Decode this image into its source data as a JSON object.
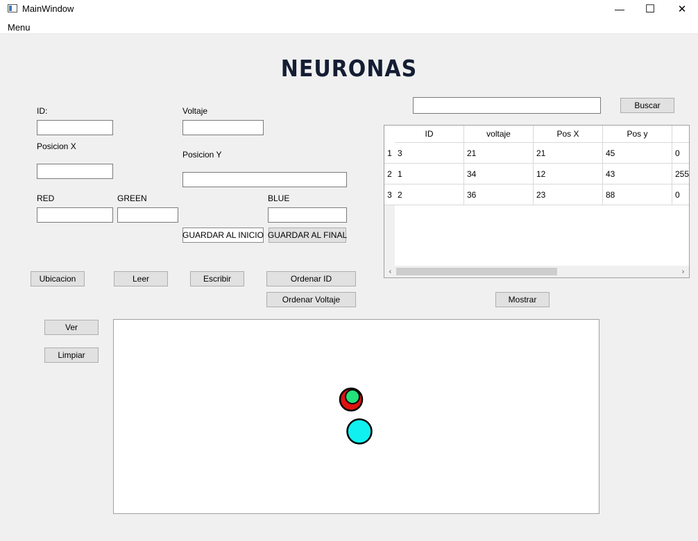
{
  "window": {
    "title": "MainWindow",
    "minimize": "—",
    "maximize": "☐",
    "close": "✕"
  },
  "menu": {
    "items": [
      "Menu"
    ]
  },
  "heading": "NEURONAS",
  "form": {
    "id_label": "ID:",
    "voltaje_label": "Voltaje",
    "posx_label": "Posicion X",
    "posy_label": "Posicion Y",
    "red_label": "RED",
    "green_label": "GREEN",
    "blue_label": "BLUE",
    "id_value": "",
    "voltaje_value": "",
    "posx_value": "",
    "posy_value": "",
    "red_value": "",
    "green_value": "",
    "blue_value": "",
    "save_start": "GUARDAR AL INICIO",
    "save_end": "GUARDAR AL FINAL"
  },
  "search": {
    "value": "",
    "button": "Buscar"
  },
  "actions": {
    "ubicacion": "Ubicacion",
    "leer": "Leer",
    "escribir": "Escribir",
    "ordenar_id": "Ordenar ID",
    "ordenar_voltaje": "Ordenar Voltaje",
    "mostrar": "Mostrar",
    "ver": "Ver",
    "limpiar": "Limpiar"
  },
  "table": {
    "headers": [
      "ID",
      "voltaje",
      "Pos X",
      "Pos y",
      ""
    ],
    "row_headers": [
      "1",
      "2",
      "3"
    ],
    "rows": [
      [
        "3",
        "21",
        "21",
        "45",
        "0"
      ],
      [
        "1",
        "34",
        "12",
        "43",
        "255"
      ],
      [
        "2",
        "36",
        "23",
        "88",
        "0"
      ]
    ]
  },
  "scene": {
    "neurons": [
      {
        "name": "neuron-red",
        "fill": "#e01010"
      },
      {
        "name": "neuron-green",
        "fill": "#22e07a"
      },
      {
        "name": "neuron-cyan",
        "fill": "#10f0f0"
      }
    ]
  }
}
